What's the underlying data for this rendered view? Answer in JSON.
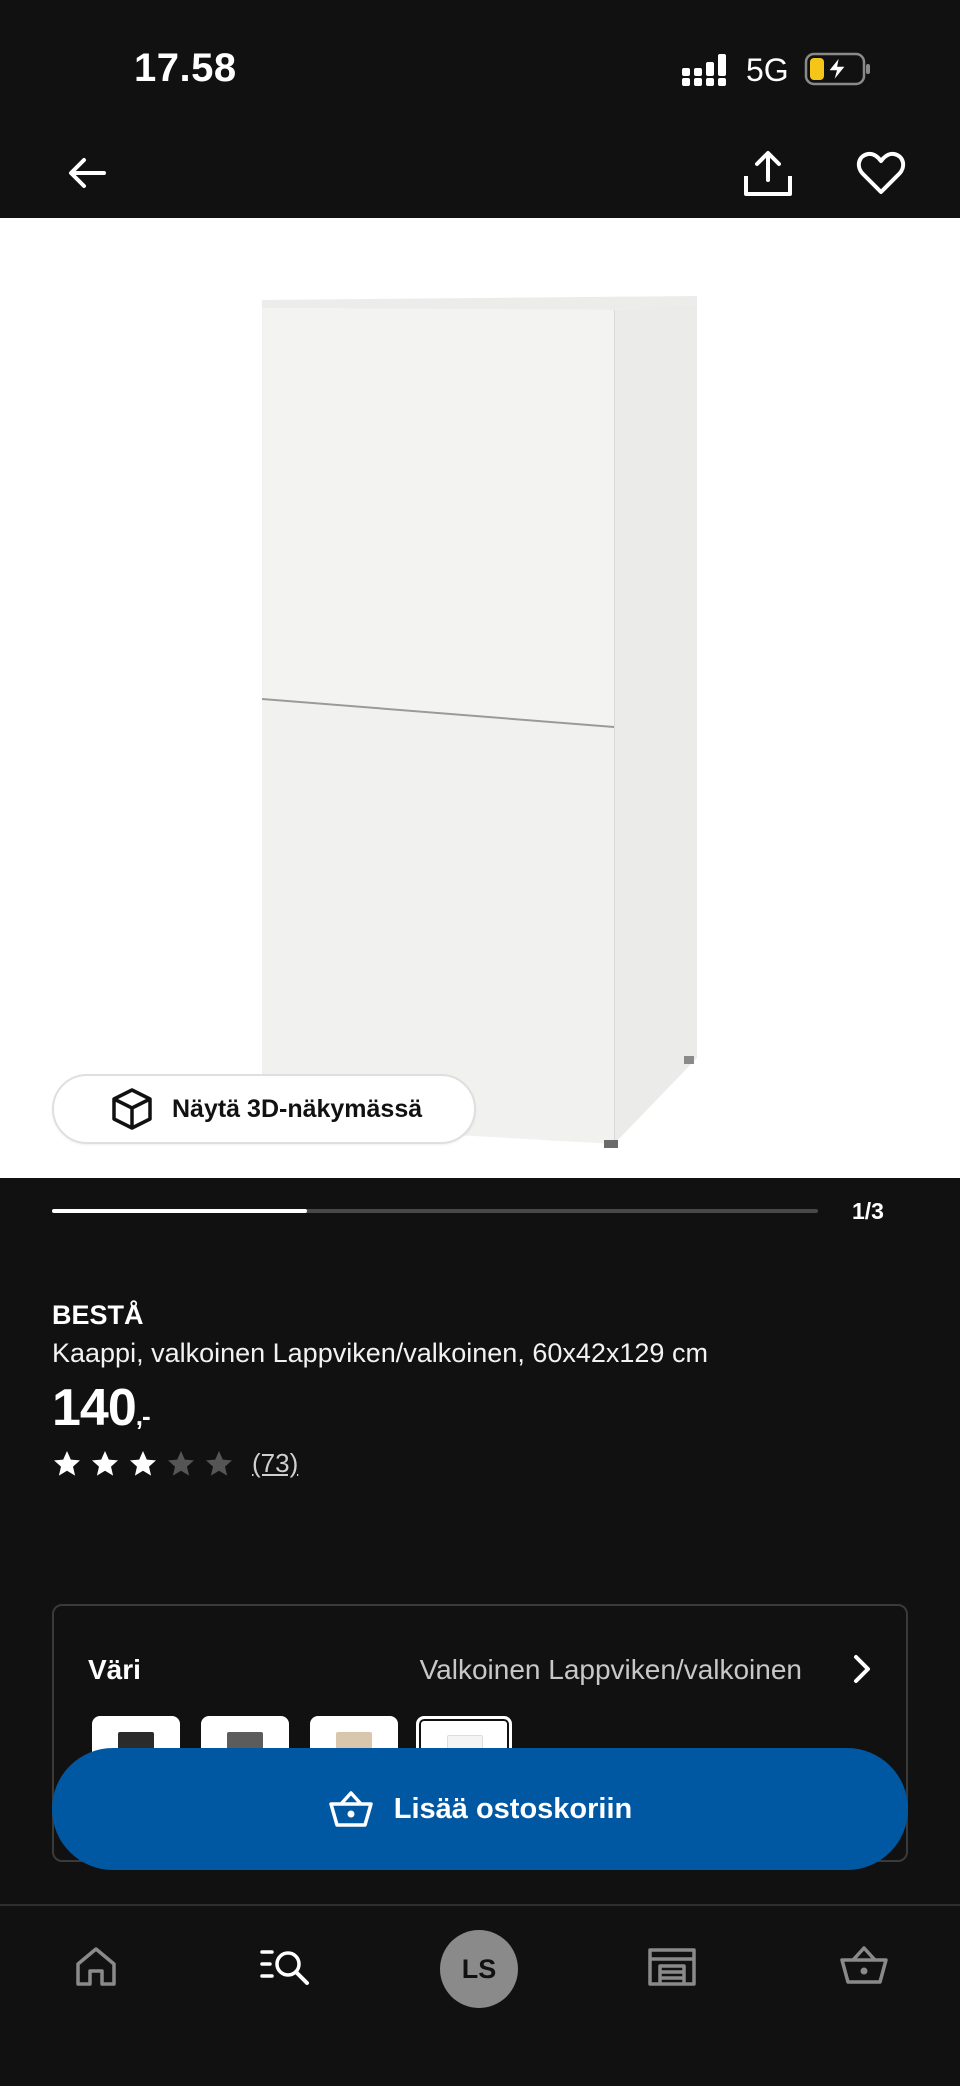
{
  "status_bar": {
    "time": "17.58",
    "network": "5G"
  },
  "nav": {
    "back_icon": "arrow-left-icon",
    "share_icon": "share-icon",
    "favorite_icon": "heart-icon"
  },
  "gallery": {
    "view_3d_label": "Näytä 3D-näkymässä",
    "page_indicator": "1/3",
    "progress_fraction": 0.333
  },
  "product": {
    "brand": "BESTÅ",
    "description": "Kaappi, valkoinen Lappviken/valkoinen, 60x42x129 cm",
    "price": "140",
    "price_suffix": ",-",
    "rating": 3,
    "rating_max": 5,
    "review_count": "(73)"
  },
  "variant": {
    "label": "Väri",
    "value": "Valkoinen Lappviken/valkoinen",
    "swatches": [
      {
        "name": "black-brown",
        "color": "#2b2b2b"
      },
      {
        "name": "dark-grey",
        "color": "#5c5c5c"
      },
      {
        "name": "oak-effect",
        "color": "#d9c7ad"
      },
      {
        "name": "white",
        "color": "#f4f4f4",
        "selected": true
      }
    ]
  },
  "cart_button": {
    "label": "Lisää ostoskoriin"
  },
  "tab_bar": {
    "tabs": [
      "home-icon",
      "search-list-icon",
      "profile-avatar",
      "store-icon",
      "cart-icon"
    ],
    "avatar_initials": "LS"
  },
  "colors": {
    "accent": "#0058a3",
    "background": "#111111",
    "battery_charge": "#f5c518"
  }
}
